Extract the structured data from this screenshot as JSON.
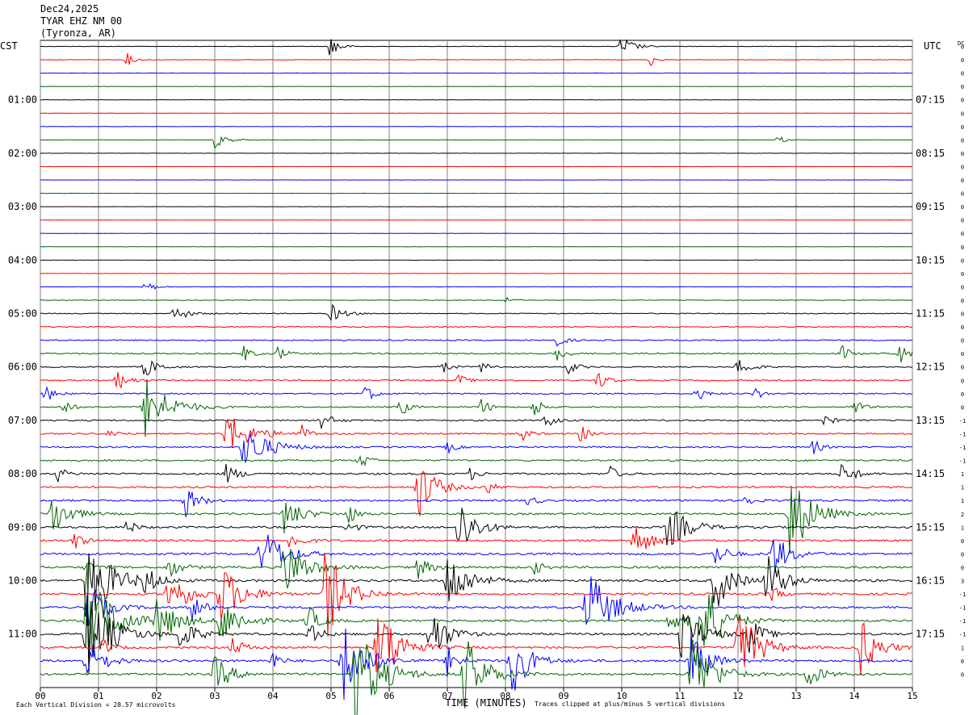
{
  "header": {
    "date": "Dec24,2025",
    "station": "TYAR EHZ NM 00",
    "location": "(Tyronza, AR)"
  },
  "labels": {
    "left_timezone": "CST",
    "right_timezone": "UTC",
    "dc_label": "DC",
    "x_axis_title": "TIME (MINUTES)",
    "footer_scale": "Each Vertical Division =   28.57 microvolts",
    "footer_clip": "Traces clipped at plus/minus 5 vertical divisions"
  },
  "colors": {
    "trace_cycle": [
      "#000000",
      "#ff0000",
      "#0000ff",
      "#006400"
    ],
    "grid": "#808080",
    "background": "#ffffff"
  },
  "chart_data": {
    "type": "helicorder",
    "x_ticks": [
      "00",
      "01",
      "02",
      "03",
      "04",
      "05",
      "06",
      "07",
      "08",
      "09",
      "10",
      "11",
      "12",
      "13",
      "14",
      "15"
    ],
    "xlim": [
      0,
      15
    ],
    "trace_count": 48,
    "minutes_per_trace": 15,
    "left_hour_labels": [
      "01:00",
      "02:00",
      "03:00",
      "04:00",
      "05:00",
      "06:00",
      "07:00",
      "08:00",
      "09:00",
      "10:00",
      "11:00"
    ],
    "right_hour_labels": [
      "07:15",
      "08:15",
      "09:15",
      "10:15",
      "11:15",
      "12:15",
      "13:15",
      "14:15",
      "15:15",
      "16:15",
      "17:15"
    ],
    "dc_offsets": [
      "0",
      "0",
      "0",
      "0",
      "0",
      "0",
      "0",
      "0",
      "0",
      "0",
      "0",
      "0",
      "0",
      "0",
      "0",
      "0",
      "0",
      "0",
      "0",
      "0",
      "0",
      "0",
      "0",
      "0",
      "0",
      "0",
      "0",
      "0",
      "-1",
      "-1",
      "-1",
      "-1",
      "1",
      "1",
      "1",
      "2",
      "1",
      "0",
      "0",
      "0",
      "3",
      "-1",
      "-1",
      "-1",
      "-1",
      "1",
      "0",
      "0"
    ],
    "activity": [
      0.15,
      0.15,
      0.1,
      0.1,
      0.15,
      0.12,
      0.12,
      0.12,
      0.1,
      0.08,
      0.08,
      0.08,
      0.08,
      0.08,
      0.1,
      0.1,
      0.12,
      0.12,
      0.15,
      0.25,
      0.35,
      0.4,
      0.45,
      0.5,
      0.45,
      0.5,
      0.5,
      0.45,
      0.55,
      0.55,
      0.55,
      0.6,
      0.65,
      0.65,
      0.7,
      0.7,
      0.75,
      0.75,
      0.8,
      0.8,
      0.85,
      0.8,
      0.8,
      0.75,
      0.8,
      0.8,
      0.85,
      0.8
    ],
    "events": [
      [
        0,
        5.0,
        2,
        18
      ],
      [
        0,
        10.0,
        3,
        14
      ],
      [
        1,
        1.5,
        2,
        8
      ],
      [
        1,
        10.5,
        1.5,
        8
      ],
      [
        7,
        3.0,
        3,
        10
      ],
      [
        7,
        12.7,
        1.5,
        6
      ],
      [
        18,
        1.8,
        2,
        10
      ],
      [
        19,
        8.0,
        1.5,
        6
      ],
      [
        20,
        2.3,
        3,
        12
      ],
      [
        20,
        5.0,
        3,
        12
      ],
      [
        22,
        8.9,
        2,
        8
      ],
      [
        23,
        3.5,
        2,
        10
      ],
      [
        23,
        4.1,
        2,
        10
      ],
      [
        23,
        8.9,
        2,
        10
      ],
      [
        23,
        13.8,
        2,
        10
      ],
      [
        23,
        14.8,
        2,
        12
      ],
      [
        24,
        1.8,
        3,
        14
      ],
      [
        24,
        6.9,
        2,
        10
      ],
      [
        24,
        7.6,
        2,
        8
      ],
      [
        24,
        9.1,
        2,
        10
      ],
      [
        24,
        12.0,
        3,
        12
      ],
      [
        25,
        1.3,
        3,
        14
      ],
      [
        25,
        7.2,
        2,
        8
      ],
      [
        25,
        9.6,
        2,
        14
      ],
      [
        26,
        0.1,
        2,
        12
      ],
      [
        26,
        5.6,
        2,
        12
      ],
      [
        26,
        11.3,
        2,
        10
      ],
      [
        26,
        12.3,
        2,
        8
      ],
      [
        27,
        0.4,
        2,
        10
      ],
      [
        27,
        1.8,
        6,
        40
      ],
      [
        27,
        6.2,
        2,
        12
      ],
      [
        27,
        7.6,
        2,
        12
      ],
      [
        27,
        8.5,
        2,
        14
      ],
      [
        27,
        14.0,
        2,
        12
      ],
      [
        28,
        4.8,
        3,
        12
      ],
      [
        28,
        8.7,
        2,
        10
      ],
      [
        28,
        13.5,
        2,
        8
      ],
      [
        29,
        1.2,
        2,
        8
      ],
      [
        29,
        3.2,
        6,
        28
      ],
      [
        29,
        4.5,
        2,
        10
      ],
      [
        29,
        8.3,
        2,
        8
      ],
      [
        29,
        9.3,
        2,
        12
      ],
      [
        30,
        3.5,
        6,
        30
      ],
      [
        30,
        7.0,
        2,
        8
      ],
      [
        30,
        13.3,
        2,
        10
      ],
      [
        31,
        5.5,
        2,
        12
      ],
      [
        32,
        0.3,
        2,
        10
      ],
      [
        32,
        3.2,
        3,
        12
      ],
      [
        32,
        7.4,
        2,
        8
      ],
      [
        32,
        9.8,
        2,
        10
      ],
      [
        32,
        13.8,
        3,
        16
      ],
      [
        33,
        6.5,
        4,
        40
      ],
      [
        33,
        7.7,
        2,
        8
      ],
      [
        34,
        2.5,
        3,
        20
      ],
      [
        34,
        8.4,
        2,
        8
      ],
      [
        34,
        12.1,
        2,
        10
      ],
      [
        35,
        0.2,
        4,
        30
      ],
      [
        35,
        4.2,
        4,
        24
      ],
      [
        35,
        5.3,
        2,
        14
      ],
      [
        35,
        12.9,
        5,
        60
      ],
      [
        36,
        1.5,
        2,
        10
      ],
      [
        36,
        5.3,
        2,
        10
      ],
      [
        36,
        7.2,
        4,
        40
      ],
      [
        36,
        10.8,
        5,
        30
      ],
      [
        37,
        0.6,
        2,
        12
      ],
      [
        37,
        4.3,
        3,
        12
      ],
      [
        37,
        10.2,
        4,
        24
      ],
      [
        38,
        3.8,
        5,
        40
      ],
      [
        38,
        11.6,
        3,
        16
      ],
      [
        38,
        12.6,
        4,
        28
      ],
      [
        39,
        0.8,
        2,
        8
      ],
      [
        39,
        2.2,
        3,
        14
      ],
      [
        39,
        4.2,
        5,
        40
      ],
      [
        39,
        6.5,
        3,
        14
      ],
      [
        39,
        8.5,
        2,
        10
      ],
      [
        40,
        0.8,
        6,
        60
      ],
      [
        40,
        1.8,
        3,
        16
      ],
      [
        40,
        7.0,
        5,
        40
      ],
      [
        40,
        11.6,
        4,
        40
      ],
      [
        40,
        12.5,
        4,
        36
      ],
      [
        41,
        2.2,
        5,
        30
      ],
      [
        41,
        3.1,
        5,
        40
      ],
      [
        41,
        4.9,
        5,
        60
      ],
      [
        41,
        12.6,
        2,
        10
      ],
      [
        42,
        0.8,
        4,
        36
      ],
      [
        42,
        2.6,
        3,
        18
      ],
      [
        42,
        9.4,
        6,
        50
      ],
      [
        43,
        0.8,
        6,
        70
      ],
      [
        43,
        2.0,
        5,
        30
      ],
      [
        43,
        3.1,
        5,
        30
      ],
      [
        43,
        4.6,
        3,
        20
      ],
      [
        43,
        10.8,
        3,
        16
      ],
      [
        43,
        11.2,
        5,
        100
      ],
      [
        44,
        0.8,
        6,
        60
      ],
      [
        44,
        2.4,
        4,
        20
      ],
      [
        44,
        4.6,
        3,
        16
      ],
      [
        44,
        6.7,
        4,
        40
      ],
      [
        44,
        11.0,
        5,
        40
      ],
      [
        44,
        12.2,
        3,
        24
      ],
      [
        45,
        1.1,
        2,
        10
      ],
      [
        45,
        3.3,
        3,
        12
      ],
      [
        45,
        5.8,
        5,
        60
      ],
      [
        45,
        12.0,
        5,
        50
      ],
      [
        45,
        14.1,
        4,
        40
      ],
      [
        46,
        0.8,
        4,
        30
      ],
      [
        46,
        4.0,
        2,
        12
      ],
      [
        46,
        5.2,
        5,
        60
      ],
      [
        46,
        7.0,
        3,
        20
      ],
      [
        46,
        8.1,
        4,
        50
      ],
      [
        46,
        11.2,
        4,
        40
      ],
      [
        47,
        3.0,
        4,
        24
      ],
      [
        47,
        5.4,
        6,
        70
      ],
      [
        47,
        7.3,
        5,
        50
      ],
      [
        47,
        11.2,
        5,
        60
      ],
      [
        47,
        13.2,
        3,
        20
      ]
    ]
  }
}
